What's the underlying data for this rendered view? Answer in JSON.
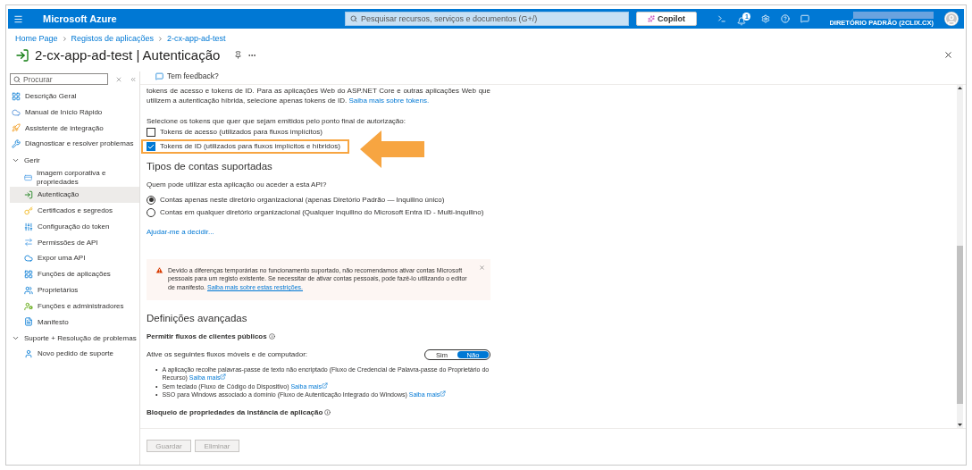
{
  "topbar": {
    "brand": "Microsoft Azure",
    "search": {
      "placeholder": "Pesquisar recursos, serviços e documentos (G+/)"
    },
    "copilot": "Copilot",
    "notification_count": "1",
    "account": "DIRETÓRIO PADRÃO (2CLIX.CX)"
  },
  "breadcrumb": [
    "Home Page",
    "Registos de aplicações",
    "2-cx-app-ad-test"
  ],
  "page": {
    "title": "2-cx-app-ad-test | Autenticação"
  },
  "sidebar": {
    "search": {
      "placeholder": "Procurar"
    },
    "items": [
      {
        "label": "Descrição Geral",
        "selected": false
      },
      {
        "label": "Manual de Início Rápido",
        "selected": false
      },
      {
        "label": "Assistente de integração",
        "selected": false
      },
      {
        "label": "Diagnosticar e resolver problemas",
        "selected": false
      },
      {
        "label": "Gerir",
        "expanded": true,
        "children": [
          {
            "label": "Imagem corporativa e propriedades",
            "selected": false
          },
          {
            "label": "Autenticação",
            "selected": true
          },
          {
            "label": "Certificados e segredos",
            "selected": false
          },
          {
            "label": "Configuração do token",
            "selected": false
          },
          {
            "label": "Permissões de API",
            "selected": false
          },
          {
            "label": "Expor uma API",
            "selected": false
          },
          {
            "label": "Funções de aplicações",
            "selected": false
          },
          {
            "label": "Proprietários",
            "selected": false
          },
          {
            "label": "Funções e administradores",
            "selected": false
          },
          {
            "label": "Manifesto",
            "selected": false
          }
        ]
      },
      {
        "label": "Suporte + Resolução de problemas",
        "expanded": true,
        "children": [
          {
            "label": "Novo pedido de suporte",
            "selected": false
          }
        ]
      }
    ]
  },
  "feedback": "Tem feedback?",
  "content": {
    "intro": {
      "text": "tokens de acesso e tokens de ID. Para as aplicações Web do ASP.NET Core e outras aplicações Web que utilizem a autenticação híbrida, selecione apenas tokens de ID.",
      "link": "Saiba mais sobre tokens."
    },
    "token_prompt": "Selecione os tokens que quer que sejam emitidos pelo ponto final de autorização:",
    "tokens": [
      {
        "label": "Tokens de acesso (utilizados para fluxos implícitos)",
        "checked": false,
        "highlighted": false
      },
      {
        "label": "Tokens de ID (utilizados para fluxos implícitos e híbridos)",
        "checked": true,
        "highlighted": true
      }
    ],
    "account_types": {
      "heading": "Tipos de contas suportadas",
      "question": "Quem pode utilizar esta aplicação ou aceder a esta API?",
      "options": [
        {
          "label": "Contas apenas neste diretório organizacional (apenas Diretório Padrão — Inquilino único)",
          "selected": true
        },
        {
          "label": "Contas em qualquer diretório organizacional (Qualquer inquilino do Microsoft Entra ID - Multi-inquilino)",
          "selected": false
        }
      ],
      "help_link": "Ajudar-me a decidir..."
    },
    "warning": {
      "text": "Devido a diferenças temporárias no funcionamento suportado, não recomendamos ativar contas Microsoft pessoais para um registo existente. Se necessitar de ativar contas pessoais, pode fazê-lo utilizando o editor de manifesto.",
      "link": "Saiba mais sobre estas restrições."
    },
    "advanced": {
      "heading": "Definições avançadas",
      "public_flows": "Permitir fluxos de clientes públicos",
      "flows_prompt": "Ative os seguintes fluxos móveis e de computador:",
      "toggle": [
        {
          "label": "Sim",
          "selected": false
        },
        {
          "label": "Não",
          "selected": true
        }
      ],
      "bullet_marker": "•",
      "bullets": [
        {
          "text": "A aplicação recolhe palavras-passe de texto não encriptado (Fluxo de Credencial de Palavra-passe do Proprietário do Recurso)",
          "link": "Saiba mais"
        },
        {
          "text": "Sem teclado (Fluxo de Código do Dispositivo)",
          "link": "Saiba mais"
        },
        {
          "text": "SSO para Windows associado a domínio (Fluxo de Autenticação Integrado do Windows)",
          "link": "Saiba mais"
        }
      ],
      "lock_label": "Bloqueio de propriedades da instância de aplicação"
    }
  },
  "footer": [
    {
      "label": "Guardar",
      "disabled": true
    },
    {
      "label": "Eliminar",
      "disabled": true
    }
  ]
}
